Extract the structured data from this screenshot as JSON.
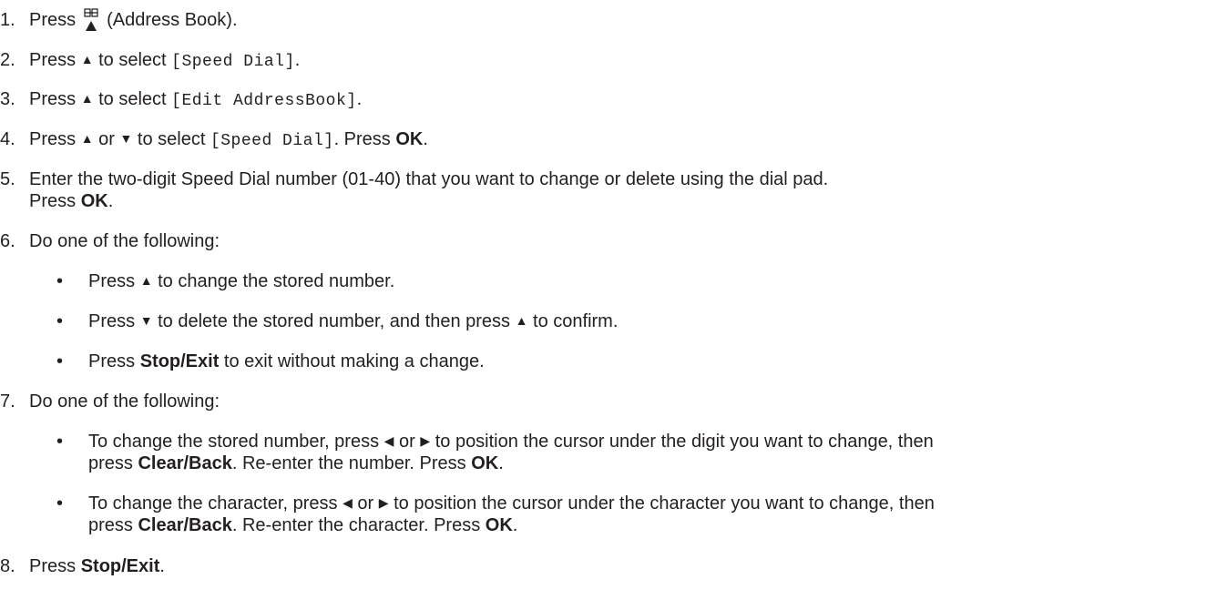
{
  "steps": {
    "s1": {
      "num": "1.",
      "a": "Press",
      "b": "(Address Book).",
      "icon": "address-book-icon"
    },
    "s2": {
      "num": "2.",
      "a": "Press",
      "arrow": "▲",
      "b": "to select",
      "code": "[Speed Dial]",
      "c": "."
    },
    "s3": {
      "num": "3.",
      "a": "Press",
      "arrow": "▲",
      "b": "to select",
      "code": "[Edit AddressBook]",
      "c": "."
    },
    "s4": {
      "num": "4.",
      "a": "Press",
      "arrow1": "▲",
      "or": "or",
      "arrow2": "▼",
      "b": "to select",
      "code": "[Speed Dial]",
      "c": ". Press",
      "key": "OK",
      "d": "."
    },
    "s5": {
      "num": "5.",
      "line1": "Enter the two-digit Speed Dial number (01-40) that you want to change or delete using the dial pad.",
      "a": "Press",
      "key": "OK",
      "b": "."
    },
    "s6": {
      "num": "6.",
      "text": "Do one of the following:",
      "b1": {
        "a": "Press",
        "arrow": "▲",
        "b": "to change the stored number."
      },
      "b2": {
        "a": "Press",
        "arrow1": "▼",
        "b": "to delete the stored number, and then press",
        "arrow2": "▲",
        "c": "to confirm."
      },
      "b3": {
        "a": "Press",
        "key": "Stop/Exit",
        "b": "to exit without making a change."
      }
    },
    "s7": {
      "num": "7.",
      "text": "Do one of the following:",
      "b1": {
        "a": "To change the stored number, press",
        "l": "◀",
        "or": "or",
        "r": "▶",
        "b": "to position the cursor under the digit you want to change, then",
        "c": "press",
        "key1": "Clear/Back",
        "d": ". Re-enter the number. Press",
        "key2": "OK",
        "e": "."
      },
      "b2": {
        "a": "To change the character, press",
        "l": "◀",
        "or": "or",
        "r": "▶",
        "b": "to position the cursor under the character you want to change, then",
        "c": "press",
        "key1": "Clear/Back",
        "d": ". Re-enter the character. Press",
        "key2": "OK",
        "e": "."
      }
    },
    "s8": {
      "num": "8.",
      "a": "Press",
      "key": "Stop/Exit",
      "b": "."
    }
  },
  "bullet": "•"
}
